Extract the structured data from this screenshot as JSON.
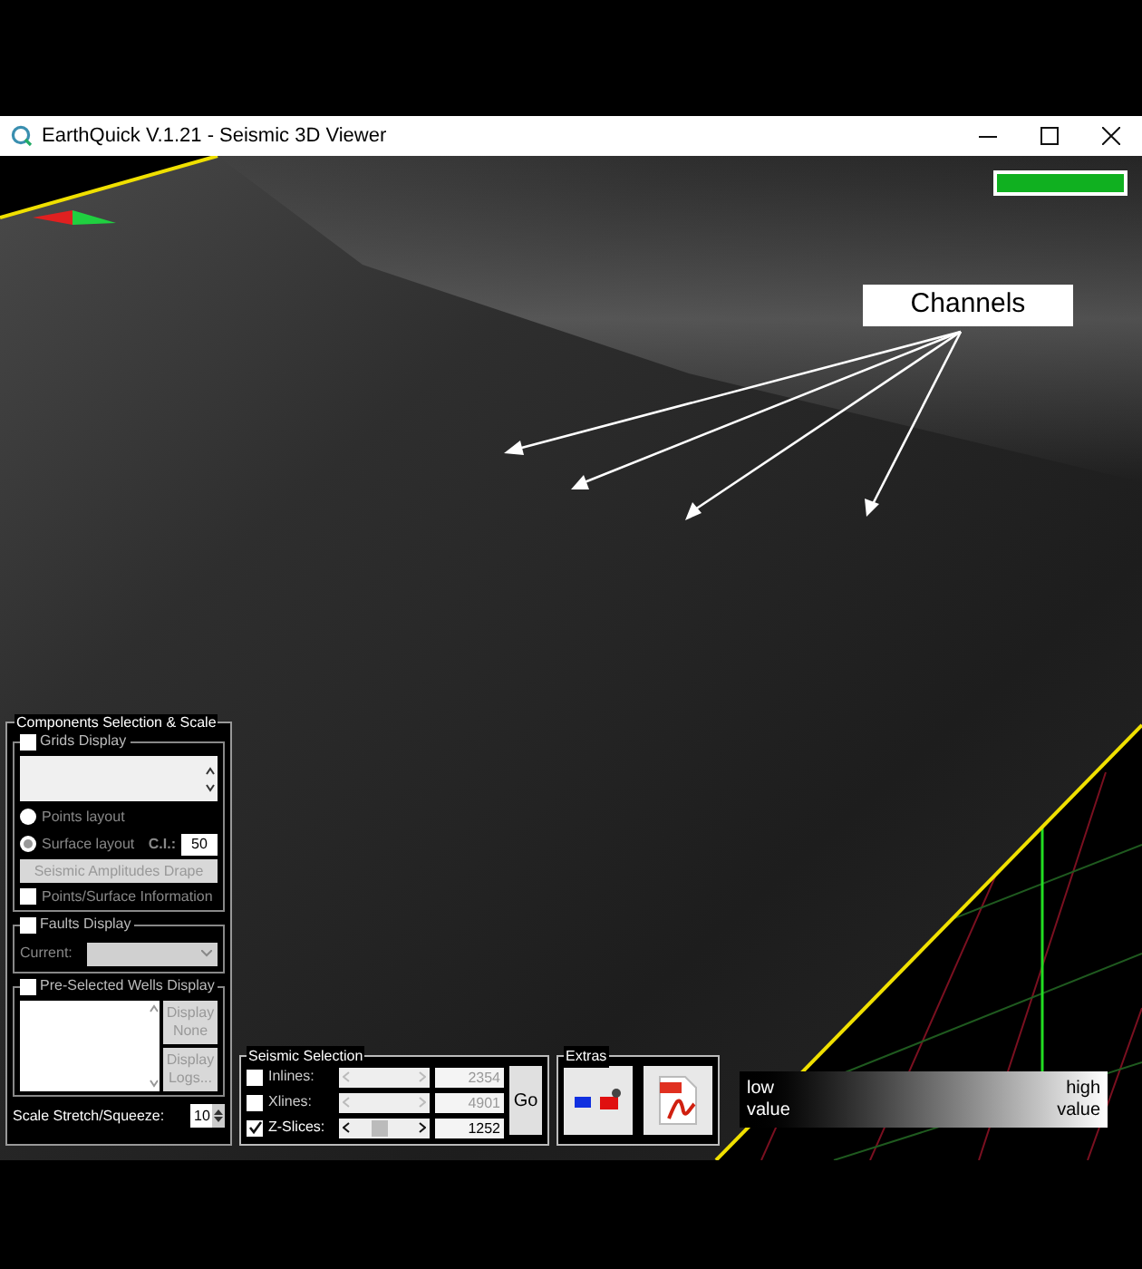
{
  "window": {
    "title": "EarthQuick V.1.21 - Seismic 3D Viewer"
  },
  "annotation": {
    "label": "Channels"
  },
  "components_panel": {
    "title": "Components Selection & Scale",
    "grids_display": {
      "label": "Grids Display",
      "checked": false,
      "enabled": false,
      "layouts": [
        {
          "label": "Points layout",
          "selected": false
        },
        {
          "label": "Surface layout",
          "selected": true
        }
      ],
      "ci_label": "C.I.:",
      "ci_value": "50",
      "drape_button": "Seismic Amplitudes Drape",
      "info": {
        "label": "Points/Surface Information",
        "checked": false
      }
    },
    "faults_display": {
      "label": "Faults Display",
      "checked": false,
      "enabled": false,
      "current_label": "Current:"
    },
    "wells_display": {
      "label": "Pre-Selected Wells Display",
      "checked": false,
      "enabled": false,
      "buttons": [
        "Display None",
        "Display Logs..."
      ]
    },
    "scale": {
      "label": "Scale Stretch/Squeeze:",
      "value": "10"
    }
  },
  "seismic_selection": {
    "title": "Seismic Selection",
    "go_button": "Go",
    "rows": [
      {
        "label": "Inlines:",
        "checked": false,
        "value": "2354"
      },
      {
        "label": "Xlines:",
        "checked": false,
        "value": "4901"
      },
      {
        "label": "Z-Slices:",
        "checked": true,
        "value": "1252",
        "level": 0.45
      }
    ]
  },
  "extras": {
    "title": "Extras"
  },
  "legend": {
    "low_label": "low value",
    "high_label": "high value"
  }
}
